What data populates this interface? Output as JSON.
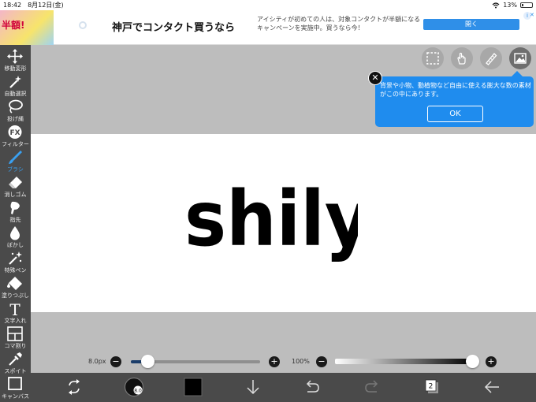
{
  "status": {
    "time": "18:42",
    "date": "8月12日(金)",
    "battery": "13%"
  },
  "ad": {
    "thumb_text": "半額!",
    "title": "神戸でコンタクト買うなら",
    "description": "アイシティが初めての人は、対象コンタクトが半額になるキャンペーンを実施中。買うなら今！",
    "open_label": "開く",
    "info_label": "i",
    "close_label": "✕"
  },
  "tools": [
    {
      "label": "移動変形",
      "icon": "move-icon"
    },
    {
      "label": "自動選択",
      "icon": "magic-wand-icon"
    },
    {
      "label": "投げ縄",
      "icon": "lasso-icon"
    },
    {
      "label": "フィルター",
      "icon": "fx-icon",
      "icon_text": "FX"
    },
    {
      "label": "ブラシ",
      "icon": "brush-icon",
      "active": true
    },
    {
      "label": "消しゴム",
      "icon": "eraser-icon"
    },
    {
      "label": "指先",
      "icon": "finger-icon"
    },
    {
      "label": "ぼかし",
      "icon": "blur-drop-icon"
    },
    {
      "label": "特殊ペン",
      "icon": "special-pen-icon"
    },
    {
      "label": "塗りつぶし",
      "icon": "fill-bucket-icon"
    },
    {
      "label": "文字入れ",
      "icon": "text-icon",
      "icon_text": "T"
    },
    {
      "label": "コマ割り",
      "icon": "panel-icon"
    },
    {
      "label": "スポイト",
      "icon": "eyedropper-icon"
    },
    {
      "label": "キャンバス",
      "icon": "canvas-icon"
    }
  ],
  "canvas_text": "shily",
  "tooltip": {
    "text": "背景や小物、動植物など自由に使える膨大な数の素材がこの中にあります。",
    "ok_label": "OK",
    "close_label": "✕"
  },
  "brush_size": {
    "label": "8.0px",
    "fraction": 0.13,
    "minus": "−",
    "plus": "+"
  },
  "opacity": {
    "label": "100%",
    "fraction": 1.0,
    "minus": "−",
    "plus": "+"
  },
  "bottom": {
    "layer_count": "2",
    "brush_preview_text": "8.0"
  },
  "colors": {
    "accent": "#1f8cee",
    "toolbar": "#4a4a4a",
    "canvas_bg": "#bdbdbd"
  }
}
